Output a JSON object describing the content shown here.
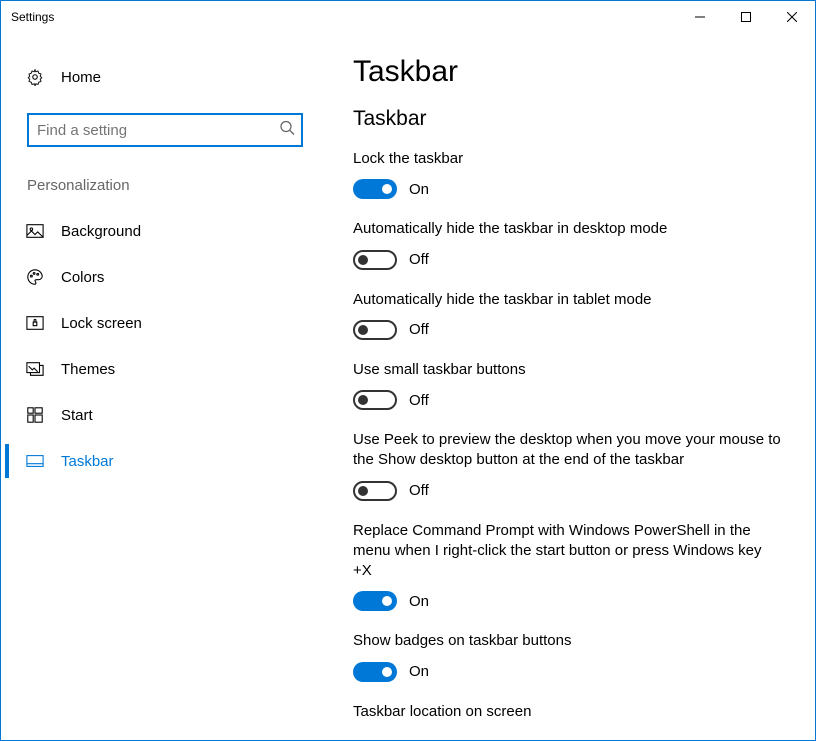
{
  "window": {
    "title": "Settings"
  },
  "sidebar": {
    "home": "Home",
    "search_placeholder": "Find a setting",
    "section": "Personalization",
    "items": [
      {
        "label": "Background"
      },
      {
        "label": "Colors"
      },
      {
        "label": "Lock screen"
      },
      {
        "label": "Themes"
      },
      {
        "label": "Start"
      },
      {
        "label": "Taskbar"
      }
    ]
  },
  "page": {
    "title": "Taskbar",
    "section": "Taskbar",
    "on_label": "On",
    "off_label": "Off",
    "settings": [
      {
        "label": "Lock the taskbar",
        "state": true
      },
      {
        "label": "Automatically hide the taskbar in desktop mode",
        "state": false
      },
      {
        "label": "Automatically hide the taskbar in tablet mode",
        "state": false
      },
      {
        "label": "Use small taskbar buttons",
        "state": false
      },
      {
        "label": "Use Peek to preview the desktop when you move your mouse to the Show desktop button at the end of the taskbar",
        "state": false
      },
      {
        "label": "Replace Command Prompt with Windows PowerShell in the menu when I right-click the start button or press Windows key +X",
        "state": true
      },
      {
        "label": "Show badges on taskbar buttons",
        "state": true
      },
      {
        "label": "Taskbar location on screen"
      }
    ]
  }
}
